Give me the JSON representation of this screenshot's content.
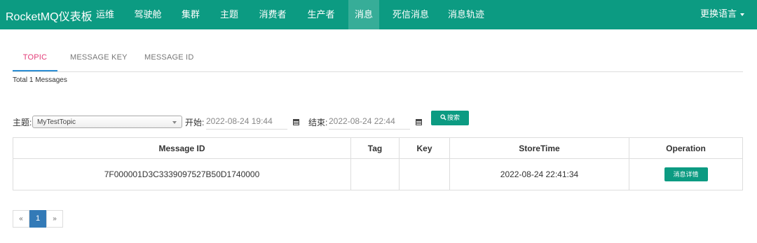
{
  "app": {
    "brand": "RocketMQ仪表板",
    "language_label": "更换语言"
  },
  "nav": {
    "items": [
      {
        "label": "运维"
      },
      {
        "label": "驾驶舱"
      },
      {
        "label": "集群"
      },
      {
        "label": "主题"
      },
      {
        "label": "消费者"
      },
      {
        "label": "生产者"
      },
      {
        "label": "消息",
        "active": true
      },
      {
        "label": "死信消息"
      },
      {
        "label": "消息轨迹"
      }
    ]
  },
  "tabs": [
    {
      "label": "TOPIC",
      "active": true
    },
    {
      "label": "MESSAGE KEY"
    },
    {
      "label": "MESSAGE ID"
    }
  ],
  "total_label": "Total 1 Messages",
  "filter": {
    "topic_label": "主题:",
    "topic_value": "MyTestTopic",
    "start_label": "开始:",
    "start_value": "2022-08-24 19:44",
    "end_label": "结束:",
    "end_value": "2022-08-24 22:44",
    "search_label": "搜索"
  },
  "table": {
    "headers": [
      "Message ID",
      "Tag",
      "Key",
      "StoreTime",
      "Operation"
    ],
    "rows": [
      {
        "message_id": "7F000001D3C3339097527B50D1740000",
        "tag": "",
        "key": "",
        "store_time": "2022-08-24 22:41:34",
        "operation_label": "消息详情"
      }
    ]
  },
  "pager": {
    "prev": "«",
    "current": "1",
    "next": "»"
  },
  "colors": {
    "primary": "#0c9b82",
    "nav_active": "#37ad98",
    "tab_active_text": "#e33b77",
    "tab_underline": "#2a8dd4",
    "pager_active": "#337ab7"
  }
}
